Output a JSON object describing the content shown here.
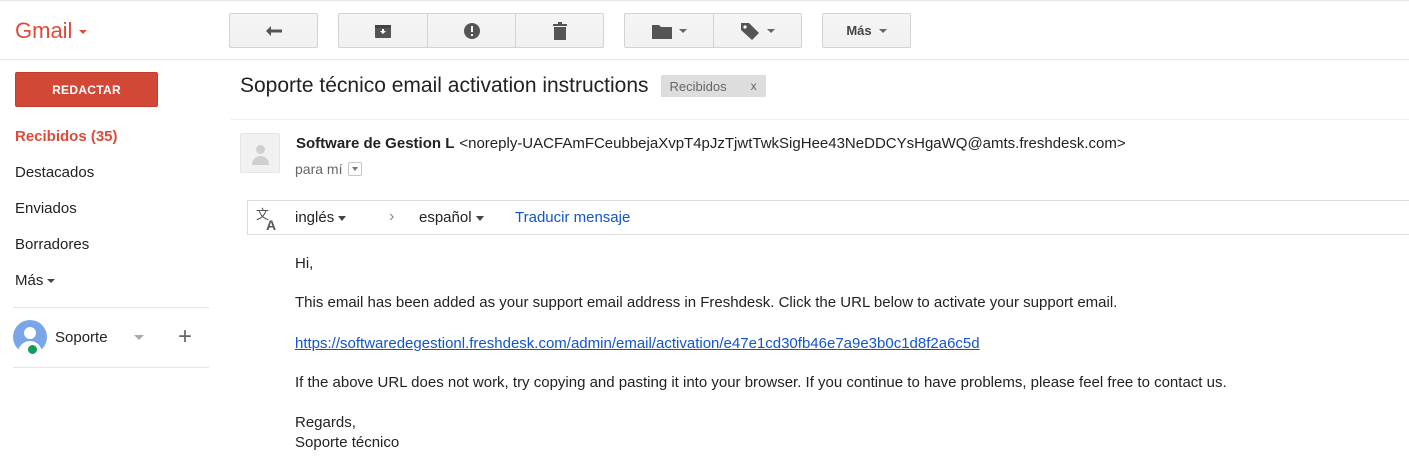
{
  "app": {
    "brand": "Gmail"
  },
  "toolbar": {
    "more_label": "Más",
    "icons": [
      "reply-icon",
      "archive-icon",
      "report-spam-icon",
      "delete-icon",
      "folder-icon",
      "label-icon"
    ]
  },
  "sidebar": {
    "compose_label": "REDACTAR",
    "items": [
      {
        "label": "Recibidos (35)",
        "active": true
      },
      {
        "label": "Destacados"
      },
      {
        "label": "Enviados"
      },
      {
        "label": "Borradores"
      },
      {
        "label": "Más"
      }
    ],
    "hangout": {
      "name": "Soporte",
      "status_color": "#0f9d58"
    }
  },
  "message": {
    "subject": "Soporte técnico email activation instructions",
    "label_chip": "Recibidos",
    "label_remove": "x",
    "sender_name": "Software de Gestion L",
    "sender_email": "<noreply-UACFAmFCeubbejaXvpT4pJzTjwtTwkSigHee43NeDDCYsHgaWQ@amts.freshdesk.com>",
    "to_text": "para mí",
    "translate": {
      "source_lang": "inglés",
      "target_lang": "español",
      "action": "Traducir mensaje"
    },
    "body": {
      "greeting": "Hi,",
      "line1": "This email has been added as your support email address in Freshdesk. Click the URL below to activate your support email.",
      "link": "https://softwaredegestionl.freshdesk.com/admin/email/activation/e47e1cd30fb46e7a9e3b0c1d8f2a6c5d",
      "line2": "If the above URL does not work, try copying and pasting it into your browser. If you continue to have problems, please feel free to contact us.",
      "closing": "Regards,",
      "signature": "Soporte técnico"
    }
  },
  "colors": {
    "brand_red": "#dd4b39",
    "compose_red": "#d14836",
    "link_blue": "#1155cc"
  }
}
